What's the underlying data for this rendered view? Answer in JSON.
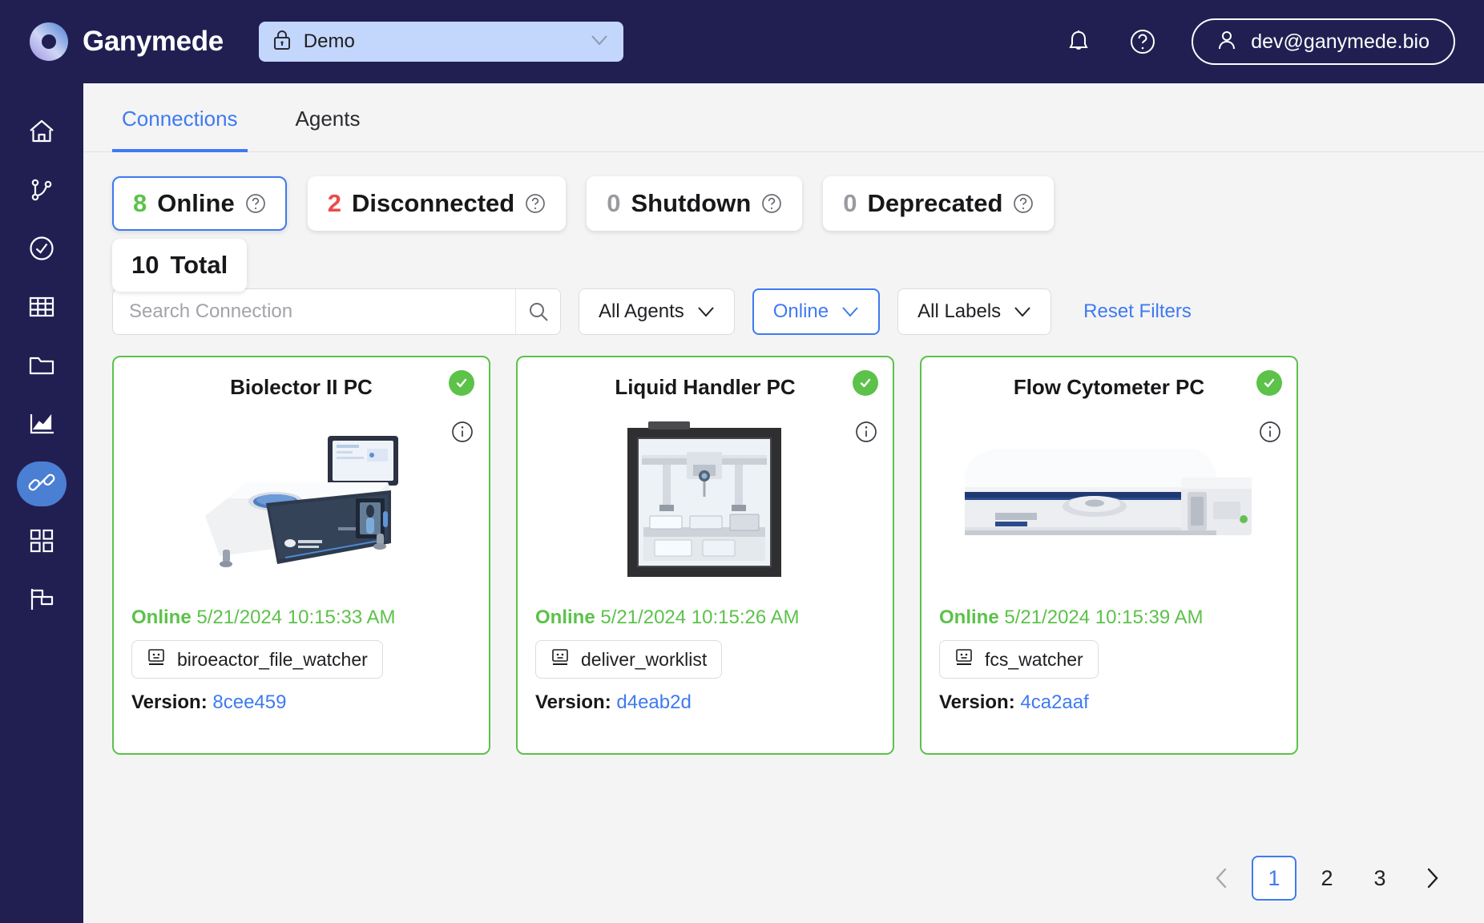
{
  "header": {
    "brand": "Ganymede",
    "brand_logo_icon": "ganymede-logo",
    "workspace": {
      "lock_icon": "lock-icon",
      "value": "Demo",
      "chevron_icon": "chevron-down-icon"
    },
    "notifications_icon": "bell-icon",
    "help_icon": "question-circle-icon",
    "user": {
      "avatar_icon": "user-icon",
      "email": "dev@ganymede.bio"
    }
  },
  "sidebar": {
    "items": [
      {
        "name": "home",
        "icon": "home-icon",
        "active": false
      },
      {
        "name": "flows",
        "icon": "branch-icon",
        "active": false
      },
      {
        "name": "tests",
        "icon": "check-circle-icon",
        "active": false
      },
      {
        "name": "tables",
        "icon": "table-icon",
        "active": false
      },
      {
        "name": "files",
        "icon": "folder-icon",
        "active": false
      },
      {
        "name": "analytics",
        "icon": "chart-icon",
        "active": false
      },
      {
        "name": "connections",
        "icon": "plug-icon",
        "active": true
      },
      {
        "name": "apps",
        "icon": "grid-icon",
        "active": false
      },
      {
        "name": "flags",
        "icon": "flag-icon",
        "active": false
      }
    ]
  },
  "tabs": [
    {
      "label": "Connections",
      "active": true
    },
    {
      "label": "Agents",
      "active": false
    }
  ],
  "stats": [
    {
      "count": "8",
      "label": "Online",
      "color": "green",
      "selected": true,
      "help_icon": "question-circle-icon"
    },
    {
      "count": "2",
      "label": "Disconnected",
      "color": "red",
      "selected": false,
      "help_icon": "question-circle-icon"
    },
    {
      "count": "0",
      "label": "Shutdown",
      "color": "grey",
      "selected": false,
      "help_icon": "question-circle-icon"
    },
    {
      "count": "0",
      "label": "Deprecated",
      "color": "grey",
      "selected": false,
      "help_icon": "question-circle-icon"
    }
  ],
  "stats_total": {
    "count": "10",
    "label": "Total"
  },
  "filters": {
    "search": {
      "placeholder": "Search Connection",
      "value": "",
      "icon": "search-icon"
    },
    "agent_filter": {
      "label": "All Agents",
      "chevron_icon": "chevron-down-icon",
      "active": false
    },
    "status_filter": {
      "label": "Online",
      "chevron_icon": "chevron-down-icon",
      "active": true
    },
    "label_filter": {
      "label": "All Labels",
      "chevron_icon": "chevron-down-icon",
      "active": false
    },
    "reset": "Reset Filters"
  },
  "connections": [
    {
      "title": "Biolector II PC",
      "status_icon": "check-circle-filled-icon",
      "info_icon": "info-icon",
      "device_image": "biolector-instrument",
      "status": "Online",
      "timestamp": "5/21/2024 10:15:33 AM",
      "tag": {
        "icon": "agent-face-icon",
        "label": "biroeactor_file_watcher"
      },
      "version_label": "Version:",
      "version": "8cee459"
    },
    {
      "title": "Liquid Handler PC",
      "status_icon": "check-circle-filled-icon",
      "info_icon": "info-icon",
      "device_image": "liquid-handler-instrument",
      "status": "Online",
      "timestamp": "5/21/2024 10:15:26 AM",
      "tag": {
        "icon": "agent-face-icon",
        "label": "deliver_worklist"
      },
      "version_label": "Version:",
      "version": "d4eab2d"
    },
    {
      "title": "Flow Cytometer PC",
      "status_icon": "check-circle-filled-icon",
      "info_icon": "info-icon",
      "device_image": "flow-cytometer-instrument",
      "status": "Online",
      "timestamp": "5/21/2024 10:15:39 AM",
      "tag": {
        "icon": "agent-face-icon",
        "label": "fcs_watcher"
      },
      "version_label": "Version:",
      "version": "4ca2aaf"
    }
  ],
  "pagination": {
    "prev_icon": "chevron-left-icon",
    "next_icon": "chevron-right-icon",
    "pages": [
      "1",
      "2",
      "3"
    ],
    "current": "1"
  },
  "colors": {
    "navy": "#211f52",
    "accent_blue": "#3f7af0",
    "online_green": "#5cc24a",
    "error_red": "#ef4a4a"
  }
}
